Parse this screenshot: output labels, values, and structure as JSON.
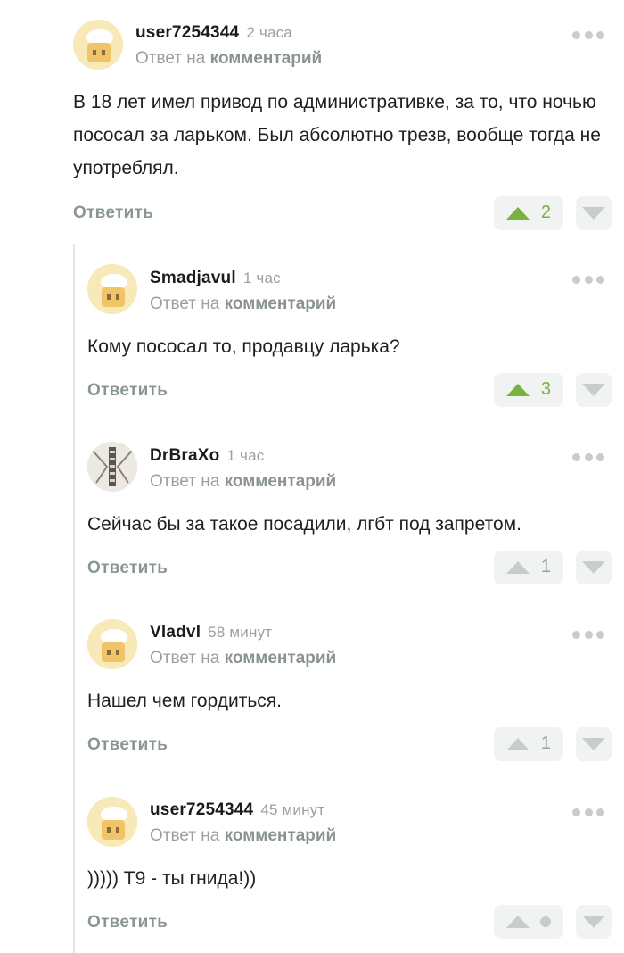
{
  "reply_prefix": "Ответ на",
  "reply_target": "комментарий",
  "reply_button": "Ответить",
  "colors": {
    "upvote_active": "#78b33f",
    "muted": "#9aa0a0",
    "vote_bg": "#f1f3f3"
  },
  "comments": [
    {
      "username": "user7254344",
      "time": "2 часа",
      "avatar": "default-avatar-icon",
      "text": "В 18 лет имел привод по административке, за то, что ночью пососал за ларьком. Был абсолютно трезв, вообще тогда не употреблял.",
      "rating": "2",
      "rated_up": true
    },
    {
      "username": "Smadjavul",
      "time": "1 час",
      "avatar": "default-avatar-icon",
      "text": "Кому пососал то, продавцу ларька?",
      "rating": "3",
      "rated_up": true
    },
    {
      "username": "DrBraXo",
      "time": "1 час",
      "avatar": "photo-avatar",
      "text": "Сейчас бы за такое посадили, лгбт под запретом.",
      "rating": "1",
      "rated_up": false
    },
    {
      "username": "Vladvl",
      "time": "58 минут",
      "avatar": "default-avatar-icon",
      "text": "Нашел чем гордиться.",
      "rating": "1",
      "rated_up": false
    },
    {
      "username": "user7254344",
      "time": "45 минут",
      "avatar": "default-avatar-icon",
      "text": "))))) Т9 - ты гнида!))",
      "rating": null,
      "rated_up": false
    }
  ]
}
